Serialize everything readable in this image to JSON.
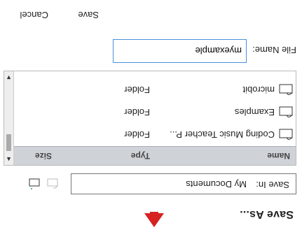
{
  "dialog": {
    "title": "Save As...",
    "save_in_label": "Save In:",
    "save_in_value": "My Documents",
    "toolbar_icons": [
      "new-folder-icon-disabled",
      "new-folder-icon"
    ]
  },
  "file_list": {
    "columns": [
      "Name",
      "Type",
      "Size"
    ],
    "rows": [
      {
        "name": "Coding Music Teacher P...",
        "type": "Folder",
        "icon": "folder-icon"
      },
      {
        "name": "Examples",
        "type": "Folder",
        "icon": "folder-icon"
      },
      {
        "name": "microbit",
        "type": "Folder",
        "icon": "folder-icon"
      }
    ]
  },
  "filename": {
    "label": "File Name:",
    "value": "myexample"
  },
  "buttons": {
    "save": "Save",
    "cancel": "Cancel"
  },
  "colors": {
    "accent": "#4a90d9",
    "arrow": "#d62222",
    "header_bg": "#cfd3d8"
  }
}
